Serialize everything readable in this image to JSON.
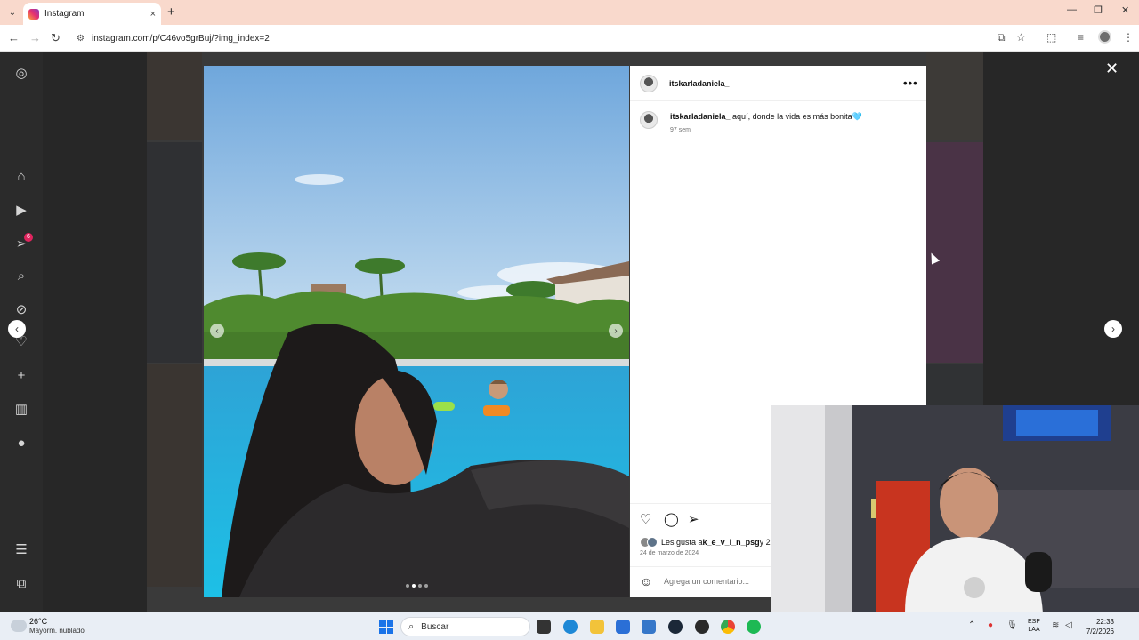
{
  "browser": {
    "tab_title": "Instagram",
    "tab_close": "×",
    "new_tab": "+",
    "url": "instagram.com/p/C46vo5grBuj/?img_index=2",
    "back": "←",
    "forward": "→",
    "reload": "↻",
    "minimize": "—",
    "restore": "❐",
    "close": "✕"
  },
  "sidebar": {
    "notifications_badge": "6",
    "items": [
      "instagram-logo-icon",
      "home-icon",
      "reels-icon",
      "messages-icon",
      "search-icon",
      "explore-icon",
      "notifications-icon",
      "create-icon",
      "dashboard-icon",
      "profile-avatar",
      "more-icon",
      "threads-icon"
    ]
  },
  "modal": {
    "close_glyph": "✕",
    "prev_glyph": "‹",
    "next_glyph": "›"
  },
  "post": {
    "username": "itskarladaniela_",
    "more_glyph": "•••",
    "caption_user": "itskarladaniela_",
    "caption_text": " aquí, donde la vida es más bonita🩵",
    "caption_time": "97 sem",
    "likes_text": "Les gusta a ",
    "likes_user": "k_e_v_i_n_psg",
    "likes_more": " y 2",
    "date": "24 de marzo de 2024",
    "comment_placeholder": "Agrega un comentario...",
    "emoji_glyph": "☺",
    "like_glyph": "♡",
    "comment_glyph": "◯",
    "share_glyph": "➢",
    "carousel_total": 4,
    "carousel_active": 2
  },
  "taskbar": {
    "temperature": "26°C",
    "weather": "Mayorm. nublado",
    "search_label": "Buscar",
    "search_glyph": "⌕",
    "lang_top": "ESP",
    "lang_bottom": "LAA",
    "time": "22:33",
    "date": "7/2/2026"
  },
  "colors": {
    "chrome_tab_bar": "#f9d9cc",
    "instagram_badge": "#e0245e",
    "taskbar": "#e9eef5",
    "start_blue": "#1a73e8"
  }
}
